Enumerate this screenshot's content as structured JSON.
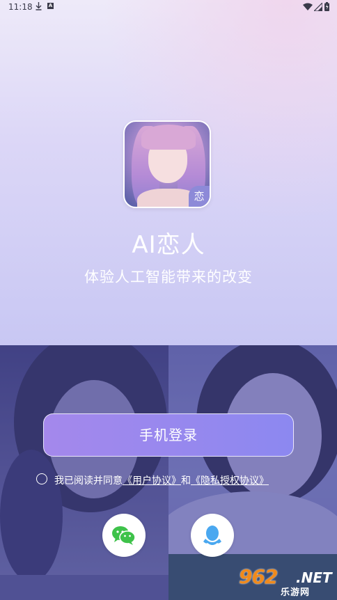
{
  "status_bar": {
    "time": "11:18",
    "notification_letter": "A"
  },
  "app": {
    "name": "AI恋人",
    "slogan": "体验人工智能带来的改变",
    "icon_badge": "恋"
  },
  "login": {
    "phone_login_label": "手机登录"
  },
  "agreement": {
    "prefix": "我已阅读并同意",
    "user_agreement": "《用户协议》",
    "and": "和",
    "privacy_agreement": "《隐私授权协议》",
    "checked": false
  },
  "social_login": {
    "wechat_icon": "wechat-icon",
    "qq_icon": "qq-icon",
    "wechat_color": "#3ec24a",
    "qq_color": "#4aa8f0"
  },
  "watermark": {
    "number": "962",
    "domain": ".NET",
    "site_name": "乐游网"
  },
  "colors": {
    "button_start": "#a488ec",
    "button_end": "#8c88f0",
    "hero_bg": "#dcd7f7"
  }
}
